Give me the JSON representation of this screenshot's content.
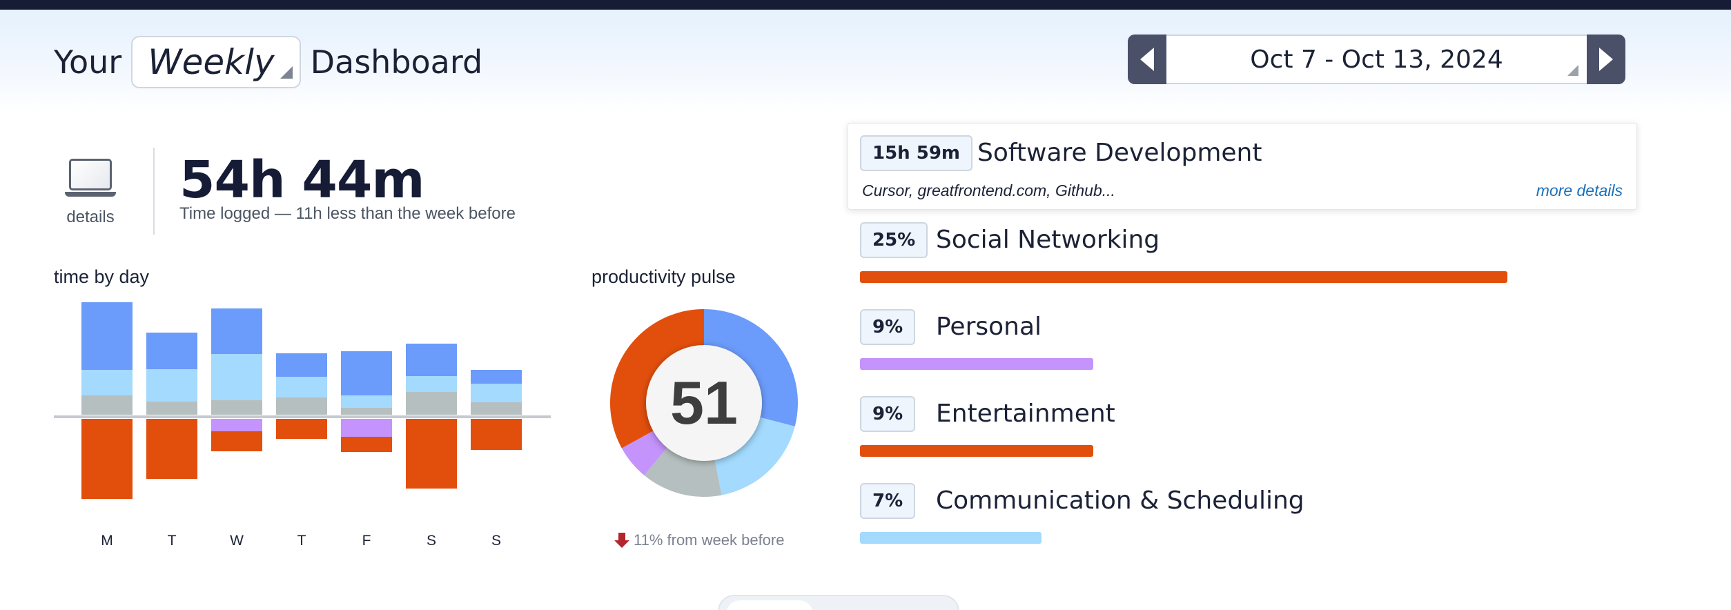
{
  "header": {
    "title_prefix": "Your",
    "title_suffix": "Dashboard",
    "period": "Weekly",
    "date_range": "Oct 7 - Oct 13, 2024"
  },
  "summary": {
    "details_label": "details",
    "total_time": "54h 44m",
    "subtitle": "Time logged — 11h less than the week before"
  },
  "colors": {
    "blue": "#6b9bfb",
    "light_blue": "#a3dafd",
    "gray": "#b6bfbf",
    "orange": "#e24f0c",
    "purple": "#c493fb",
    "dark_navy": "#161c36"
  },
  "time_by_day": {
    "title": "time by day",
    "chart_data": {
      "type": "bar",
      "stacked": true,
      "diverging": true,
      "categories": [
        "M",
        "T",
        "W",
        "T",
        "F",
        "S",
        "S"
      ],
      "series": [
        {
          "color": "#b6bfbf",
          "side": "positive",
          "values": [
            28,
            19,
            21,
            25,
            10,
            33,
            18
          ]
        },
        {
          "color": "#a3dafd",
          "side": "positive",
          "values": [
            37,
            47,
            67,
            30,
            18,
            23,
            27
          ]
        },
        {
          "color": "#6b9bfb",
          "side": "positive",
          "values": [
            98,
            53,
            66,
            34,
            64,
            47,
            20
          ]
        },
        {
          "color": "#c493fb",
          "side": "negative",
          "values": [
            0,
            0,
            18,
            0,
            26,
            0,
            0
          ]
        },
        {
          "color": "#e24f0c",
          "side": "negative",
          "values": [
            116,
            87,
            29,
            29,
            22,
            101,
            45
          ]
        }
      ]
    }
  },
  "productivity_pulse": {
    "title": "productivity pulse",
    "score": "51",
    "change_text": "11% from week before",
    "chart_data": {
      "type": "pie",
      "donut": true,
      "slices": [
        {
          "color": "#6b9bfb",
          "value": 29
        },
        {
          "color": "#a3dafd",
          "value": 18
        },
        {
          "color": "#b6bfbf",
          "value": 14
        },
        {
          "color": "#c493fb",
          "value": 6
        },
        {
          "color": "#e24f0c",
          "value": 33
        }
      ]
    }
  },
  "categories": {
    "top": {
      "badge": "15h 59m",
      "name": "Software Development",
      "apps": "Cursor, greatfrontend.com, Github...",
      "more_link": "more details"
    },
    "items": [
      {
        "badge": "25%",
        "name": "Social Networking",
        "value": 25,
        "color": "#e24f0c"
      },
      {
        "badge": "9%",
        "name": "Personal",
        "value": 9,
        "color": "#c493fb"
      },
      {
        "badge": "9%",
        "name": "Entertainment",
        "value": 9,
        "color": "#e24f0c"
      },
      {
        "badge": "7%",
        "name": "Communication & Scheduling",
        "value": 7,
        "color": "#a3dafd"
      }
    ]
  }
}
